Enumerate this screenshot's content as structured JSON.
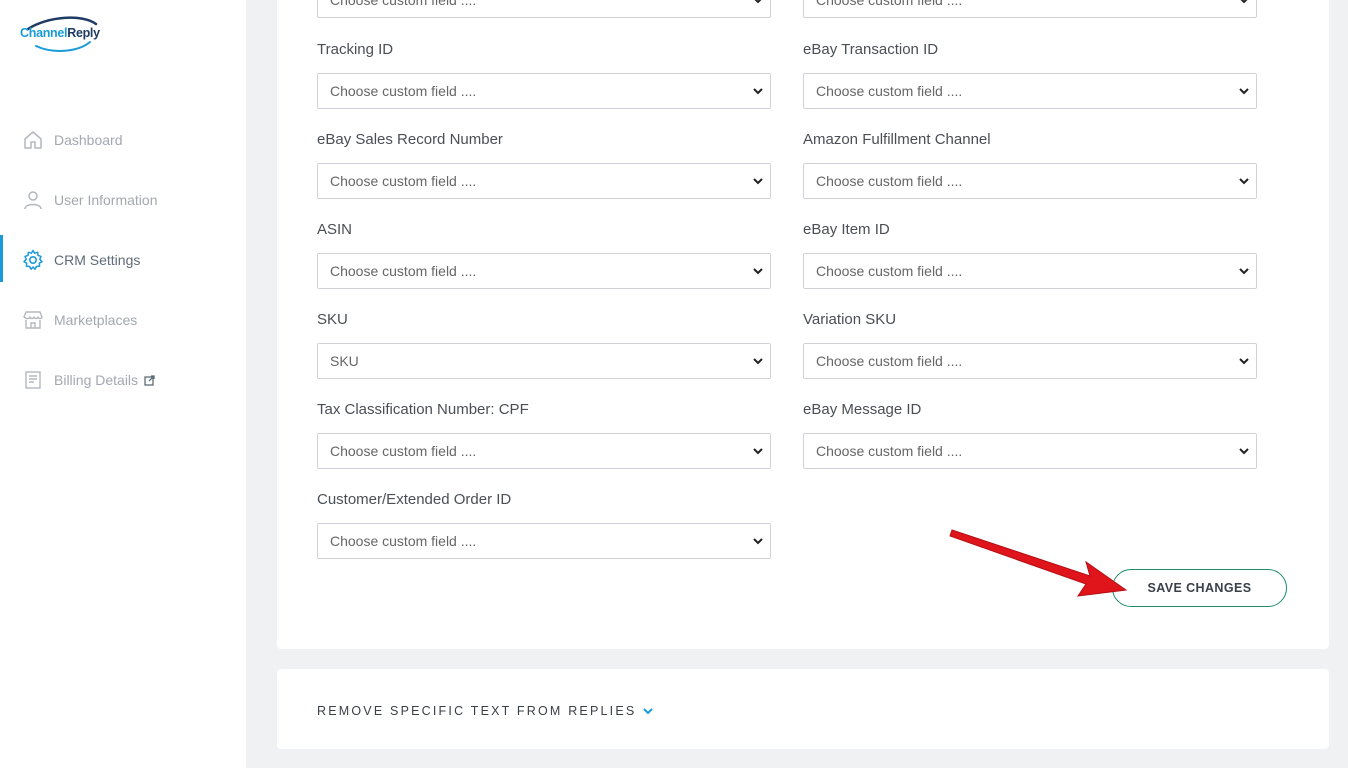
{
  "brand": {
    "part1": "Channel",
    "part2": "Reply"
  },
  "sidebar": {
    "items": [
      {
        "label": "Dashboard",
        "icon": "home-icon",
        "active": false
      },
      {
        "label": "User Information",
        "icon": "user-icon",
        "active": false
      },
      {
        "label": "CRM Settings",
        "icon": "gear-icon",
        "active": true
      },
      {
        "label": "Marketplaces",
        "icon": "store-icon",
        "active": false
      },
      {
        "label": "Billing Details",
        "icon": "receipt-icon",
        "active": false,
        "external": true
      }
    ]
  },
  "form": {
    "placeholder": "Choose custom field ....",
    "top_left_value": "Choose custom field ....",
    "top_right_value": "Choose custom field ....",
    "fields": [
      {
        "label": "Tracking ID",
        "value": "Choose custom field ...."
      },
      {
        "label": "eBay Transaction ID",
        "value": "Choose custom field ...."
      },
      {
        "label": "eBay Sales Record Number",
        "value": "Choose custom field ...."
      },
      {
        "label": "Amazon Fulfillment Channel",
        "value": "Choose custom field ...."
      },
      {
        "label": "ASIN",
        "value": "Choose custom field ...."
      },
      {
        "label": "eBay Item ID",
        "value": "Choose custom field ...."
      },
      {
        "label": "SKU",
        "value": "SKU"
      },
      {
        "label": "Variation SKU",
        "value": "Choose custom field ...."
      },
      {
        "label": "Tax Classification Number: CPF",
        "value": "Choose custom field ...."
      },
      {
        "label": "eBay Message ID",
        "value": "Choose custom field ...."
      },
      {
        "label": "Customer/Extended Order ID",
        "value": "Choose custom field ...."
      }
    ],
    "save_label": "SAVE CHANGES"
  },
  "section2": {
    "title": "REMOVE SPECIFIC TEXT FROM REPLIES",
    "icon": "chevron-down-icon"
  },
  "colors": {
    "accent": "#1a9bd7",
    "save_border": "#1e8c6b",
    "arrow": "#e0151b"
  }
}
